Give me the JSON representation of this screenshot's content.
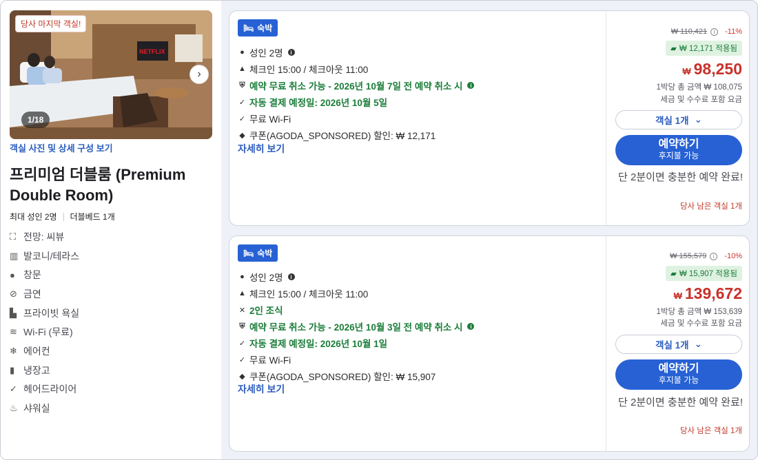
{
  "room": {
    "photo_badge": "당사 마지막 객실!",
    "photo_count": "1/18",
    "photo_link": "객실 사진 및 상세 구성 보기",
    "title": "프리미엄 더블룸 (Premium Double Room)",
    "max_guests": "최대 성인 2명",
    "bed": "더블베드 1개",
    "amenities": [
      {
        "icon": "view-icon",
        "label": "전망: 씨뷰"
      },
      {
        "icon": "balcony-icon",
        "label": "발코니/테라스"
      },
      {
        "icon": "window-icon",
        "label": "창문"
      },
      {
        "icon": "no-smoking-icon",
        "label": "금연"
      },
      {
        "icon": "bathtub-icon",
        "label": "프라이빗 욕실"
      },
      {
        "icon": "wifi-icon",
        "label": "Wi-Fi (무료)"
      },
      {
        "icon": "aircon-icon",
        "label": "에어컨"
      },
      {
        "icon": "fridge-icon",
        "label": "냉장고"
      },
      {
        "icon": "hairdryer-icon",
        "label": "헤어드라이어"
      },
      {
        "icon": "shower-icon",
        "label": "샤워실"
      }
    ]
  },
  "offers": [
    {
      "tag": "숙박",
      "guests": "성인 2명",
      "checkin": "체크인 15:00 / 체크아웃 11:00",
      "breakfast": null,
      "cancel": "예약 무료 취소 가능 - 2026년 10월 7일 전 예약 취소 시",
      "autopay": "자동 결제 예정일: 2026년 10월 5일",
      "wifi": "무료 Wi-Fi",
      "coupon_line": "쿠폰(AGODA_SPONSORED) 할인: ₩ 12,171",
      "more": "자세히 보기",
      "original_price": "₩ 110,421",
      "discount": "-11%",
      "coupon_applied": "₩ 12,171 적용됨",
      "currency": "₩",
      "price": "98,250",
      "total_per_night": "1박당 총 금액 ₩ 108,075",
      "tax_note": "세금 및 수수료 포함 요금",
      "rooms": "객실 1개",
      "book": "예약하기",
      "pay_later": "후지불 가능",
      "promo": "단 2분이면 충분한 예약 완료!",
      "remaining": "당사 남은 객실 1개"
    },
    {
      "tag": "숙박",
      "guests": "성인 2명",
      "checkin": "체크인 15:00 / 체크아웃 11:00",
      "breakfast": "2인 조식",
      "cancel": "예약 무료 취소 가능 - 2026년 10월 3일 전 예약 취소 시",
      "autopay": "자동 결제 예정일: 2026년 10월 1일",
      "wifi": "무료 Wi-Fi",
      "coupon_line": "쿠폰(AGODA_SPONSORED) 할인: ₩ 15,907",
      "more": "자세히 보기",
      "original_price": "₩ 155,579",
      "discount": "-10%",
      "coupon_applied": "₩ 15,907 적용됨",
      "currency": "₩",
      "price": "139,672",
      "total_per_night": "1박당 총 금액 ₩ 153,639",
      "tax_note": "세금 및 수수료 포함 요금",
      "rooms": "객실 1개",
      "book": "예약하기",
      "pay_later": "후지불 가능",
      "promo": "단 2분이면 충분한 예약 완료!",
      "remaining": "당사 남은 객실 1개"
    }
  ]
}
